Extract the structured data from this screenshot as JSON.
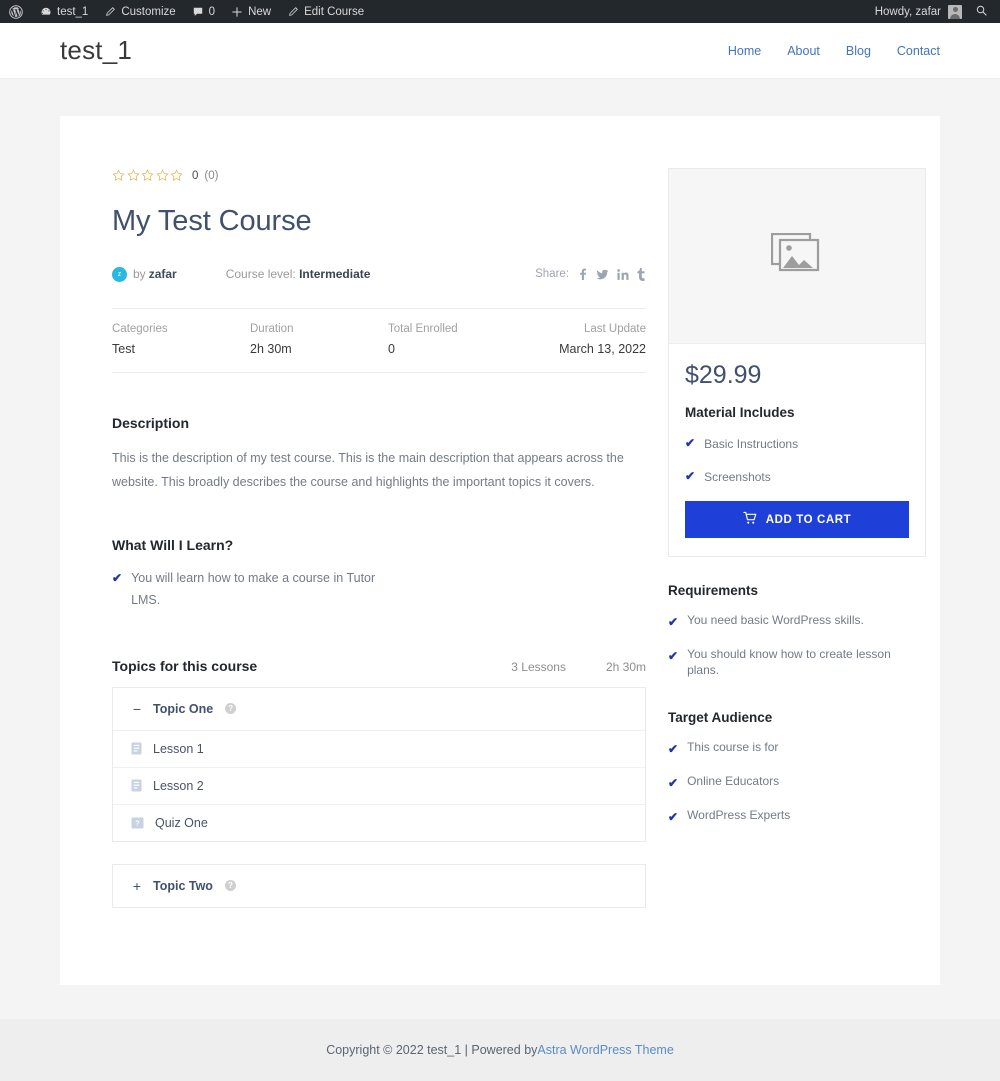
{
  "adminbar": {
    "items": [
      {
        "icon": "wordpress-logo-icon",
        "label": ""
      },
      {
        "icon": "dashboard-icon",
        "label": "test_1"
      },
      {
        "icon": "pencil-icon",
        "label": "Customize"
      },
      {
        "icon": "comment-icon",
        "label": "0"
      },
      {
        "icon": "plus-icon",
        "label": "New"
      },
      {
        "icon": "edit-icon",
        "label": "Edit Course"
      }
    ],
    "howdy": "Howdy, zafar",
    "search_icon": "search-icon"
  },
  "header": {
    "site_title": "test_1",
    "nav": [
      {
        "label": "Home"
      },
      {
        "label": "About"
      },
      {
        "label": "Blog"
      },
      {
        "label": "Contact"
      }
    ]
  },
  "course": {
    "rating": {
      "stars": 5,
      "filled": 0,
      "value": "0",
      "count": "(0)"
    },
    "title": "My Test Course",
    "author_initial": "z",
    "by_label": "by",
    "author": "zafar",
    "level_label": "Course level:",
    "level_value": "Intermediate",
    "share_label": "Share:",
    "share_icons": [
      "facebook-icon",
      "twitter-icon",
      "linkedin-icon",
      "tumblr-icon"
    ],
    "meta": [
      {
        "label": "Categories",
        "value": "Test"
      },
      {
        "label": "Duration",
        "value": "2h 30m"
      },
      {
        "label": "Total Enrolled",
        "value": "0"
      },
      {
        "label": "Last Update",
        "value": "March 13, 2022"
      }
    ],
    "description_heading": "Description",
    "description_text": "This is the description of my test course. This is the main description that appears across the website. This broadly describes the course and highlights the important topics it covers.",
    "learn_heading": "What Will I Learn?",
    "learn_items": [
      "You will learn how to make a course in Tutor LMS."
    ],
    "topics_heading": "Topics for this course",
    "topics_lessons": "3 Lessons",
    "topics_duration": "2h 30m",
    "topics": [
      {
        "title": "Topic One",
        "expanded": true,
        "toggle": "−",
        "help_icon": "question-mark-icon",
        "lessons": [
          {
            "icon": "lesson-document-icon",
            "title": "Lesson 1"
          },
          {
            "icon": "lesson-document-icon",
            "title": "Lesson 2"
          },
          {
            "icon": "quiz-icon",
            "title": "Quiz One"
          }
        ]
      },
      {
        "title": "Topic Two",
        "expanded": false,
        "toggle": "+",
        "help_icon": "question-mark-icon",
        "lessons": []
      }
    ]
  },
  "sidebar": {
    "thumbnail_icon": "image-placeholder-icon",
    "price": "$29.99",
    "material_heading": "Material Includes",
    "material_items": [
      "Basic Instructions",
      "Screenshots"
    ],
    "cart_button": "ADD TO CART",
    "cart_icon": "shopping-cart-icon",
    "requirements_heading": "Requirements",
    "requirements": [
      "You need basic WordPress skills.",
      "You should know how to create lesson plans."
    ],
    "audience_heading": "Target Audience",
    "audience": [
      "This course is for",
      "Online Educators",
      "WordPress Experts"
    ]
  },
  "footer": {
    "text_before": "Copyright © 2022 test_1 | Powered by ",
    "link": "Astra WordPress Theme"
  },
  "colors": {
    "accent_blue": "#1e40d8",
    "link_blue": "#4274ba",
    "title_navy": "#41506b",
    "star_gold": "#e2b04a",
    "avatar_cyan": "#29b8e3",
    "adminbar_dark": "#23282d"
  }
}
